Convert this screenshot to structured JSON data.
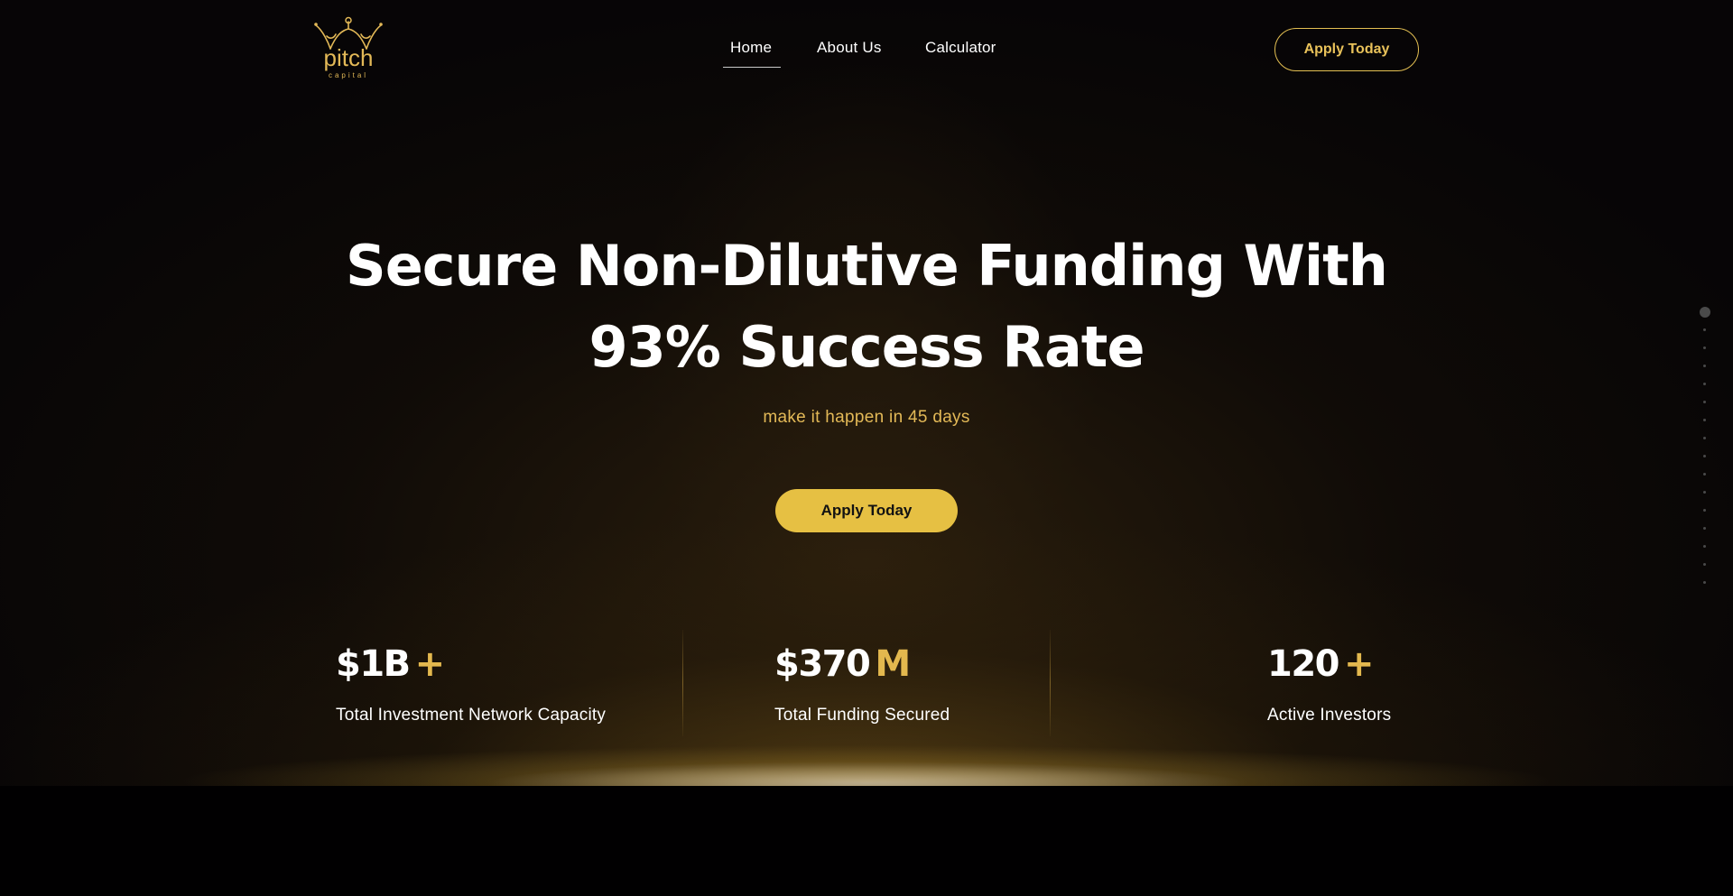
{
  "brand": {
    "logo_primary": "pitch",
    "logo_secondary": "capital",
    "accent_color": "#e6c043",
    "icon": "crown-icon"
  },
  "nav": {
    "items": [
      {
        "label": "Home",
        "active": true
      },
      {
        "label": "About Us",
        "active": false
      },
      {
        "label": "Calculator",
        "active": false
      }
    ],
    "apply_label": "Apply Today"
  },
  "hero": {
    "headline_line1": "Secure Non-Dilutive Funding With",
    "headline_line2": "93% Success Rate",
    "subline": "make it happen in 45 days",
    "cta_label": "Apply Today"
  },
  "stats": [
    {
      "value": "$1B",
      "suffix": "+",
      "label": "Total Investment Network Capacity"
    },
    {
      "value": "$370",
      "suffix": "M",
      "label": "Total Funding Secured"
    },
    {
      "value": "120",
      "suffix": "+",
      "label": "Active Investors"
    }
  ],
  "side_nav": {
    "dot_count": 16,
    "active_index": 0
  }
}
